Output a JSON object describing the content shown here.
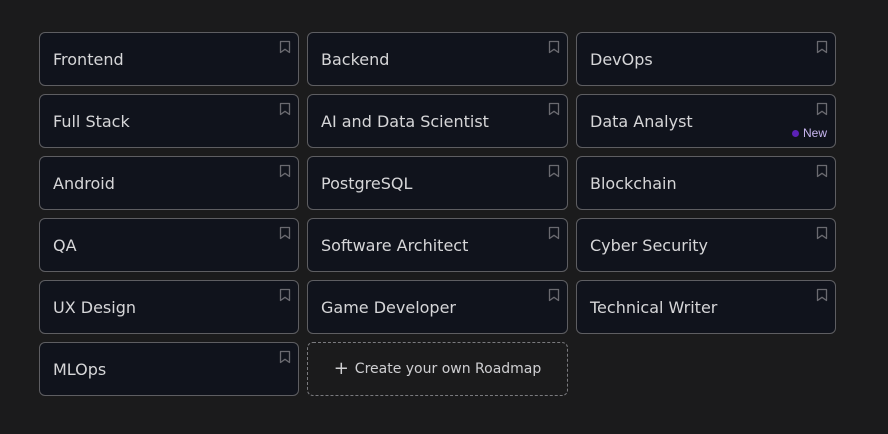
{
  "roadmaps": [
    {
      "label": "Frontend",
      "bookmark_icon": "bookmark-icon"
    },
    {
      "label": "Backend",
      "bookmark_icon": "bookmark-icon"
    },
    {
      "label": "DevOps",
      "bookmark_icon": "bookmark-icon"
    },
    {
      "label": "Full Stack",
      "bookmark_icon": "bookmark-icon"
    },
    {
      "label": "AI and Data Scientist",
      "bookmark_icon": "bookmark-icon"
    },
    {
      "label": "Data Analyst",
      "bookmark_icon": "bookmark-icon",
      "badge": "New"
    },
    {
      "label": "Android",
      "bookmark_icon": "bookmark-icon"
    },
    {
      "label": "PostgreSQL",
      "bookmark_icon": "bookmark-icon"
    },
    {
      "label": "Blockchain",
      "bookmark_icon": "bookmark-icon"
    },
    {
      "label": "QA",
      "bookmark_icon": "bookmark-icon"
    },
    {
      "label": "Software Architect",
      "bookmark_icon": "bookmark-icon"
    },
    {
      "label": "Cyber Security",
      "bookmark_icon": "bookmark-icon"
    },
    {
      "label": "UX Design",
      "bookmark_icon": "bookmark-icon"
    },
    {
      "label": "Game Developer",
      "bookmark_icon": "bookmark-icon"
    },
    {
      "label": "Technical Writer",
      "bookmark_icon": "bookmark-icon"
    },
    {
      "label": "MLOps",
      "bookmark_icon": "bookmark-icon"
    }
  ],
  "create_card": {
    "icon": "plus-icon",
    "plus_glyph": "+",
    "label": "Create your own Roadmap"
  },
  "colors": {
    "page_background": "#1b1b1c",
    "card_background": "#10131c",
    "card_border": "#5e5e62",
    "badge_dot": "#5b21b6",
    "badge_text": "#c8b6f0"
  }
}
